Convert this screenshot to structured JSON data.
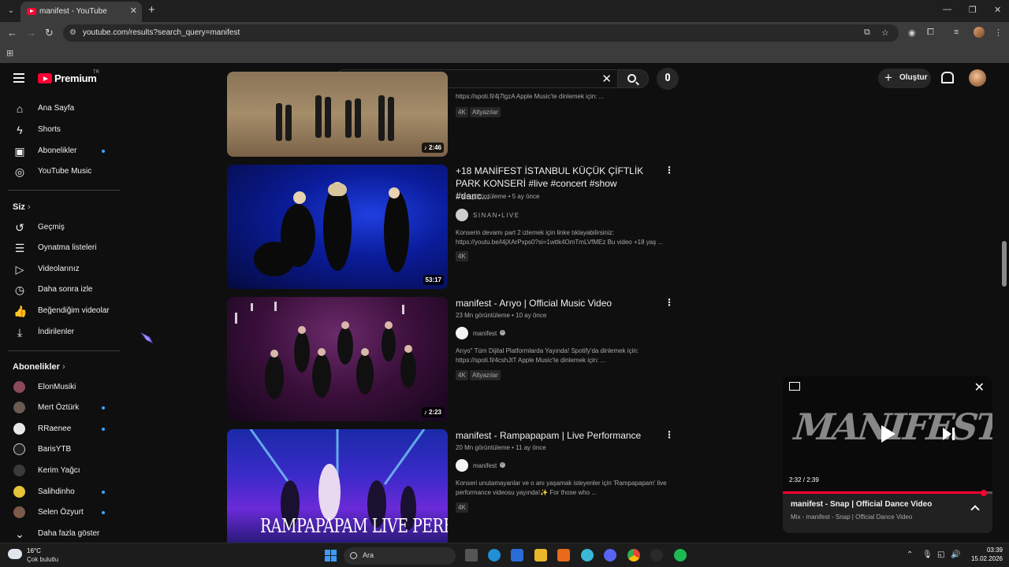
{
  "browser": {
    "tab_title": "manifest - YouTube",
    "tab_close": "✕",
    "new_tab": "+",
    "url": "youtube.com/results?search_query=manifest",
    "window_controls": [
      "—",
      "❐",
      "✕"
    ]
  },
  "masthead": {
    "logo_text": "Premium",
    "region": "TR",
    "search_value": "manifest",
    "create_label": "Oluştur"
  },
  "sidebar": {
    "main": [
      {
        "label": "Ana Sayfa",
        "icon": "home-icon",
        "glyph": "⌂"
      },
      {
        "label": "Shorts",
        "icon": "shorts-icon",
        "glyph": "ϟ"
      },
      {
        "label": "Abonelikler",
        "icon": "subscriptions-icon",
        "glyph": "▣",
        "dot": true
      },
      {
        "label": "YouTube Music",
        "icon": "youtube-music-icon",
        "glyph": "◎"
      }
    ],
    "you_heading": "Siz",
    "you": [
      {
        "label": "Geçmiş",
        "icon": "history-icon",
        "glyph": "↺"
      },
      {
        "label": "Oynatma listeleri",
        "icon": "playlists-icon",
        "glyph": "☰"
      },
      {
        "label": "Videolarınız",
        "icon": "your-videos-icon",
        "glyph": "▷"
      },
      {
        "label": "Daha sonra izle",
        "icon": "watch-later-icon",
        "glyph": "◷"
      },
      {
        "label": "Beğendiğim videolar",
        "icon": "liked-videos-icon",
        "glyph": "👍"
      },
      {
        "label": "İndirilenler",
        "icon": "downloads-icon",
        "glyph": "⤓"
      }
    ],
    "subs_heading": "Abonelikler",
    "subs": [
      {
        "label": "ElonMusiki",
        "color": "#8a4a5a",
        "dot": false
      },
      {
        "label": "Mert Öztürk",
        "color": "#6a5a50",
        "dot": true
      },
      {
        "label": "RRaenee",
        "color": "#e8e8e8",
        "dot": true
      },
      {
        "label": "BarisYTB",
        "color": "#222222",
        "dot": false
      },
      {
        "label": "Kerim Yağcı",
        "color": "#3a3a3a",
        "dot": false
      },
      {
        "label": "Salihdinho",
        "color": "#e6c43a",
        "dot": true
      },
      {
        "label": "Selen Özyurt",
        "color": "#7a5a4a",
        "dot": true
      }
    ],
    "show_more": "Daha fazla göster"
  },
  "results": [
    {
      "title": "",
      "meta": "",
      "channel": "",
      "desc": "https://spoti.fi/4j7lgzA Apple Music'te dinlemek için: ...",
      "badges": [
        "4K",
        "Altyazılar"
      ],
      "duration": "2:46",
      "music": true
    },
    {
      "title": "+18 MANİFEST İSTANBUL KÜÇÜK ÇİFTLİK PARK KONSERİ #live #concert #show #danc...",
      "meta": "1 Mn görüntüleme • 5 ay önce",
      "channel": "SINAN•LIVE",
      "verified": false,
      "desc": "Konserin devamı part 2 izlemek için linke tıklayabilirsiniz: https://youtu.be/l4jXArPxps0?si=1wttk4OmTmLVfMEz Bu video +18 yaş ...",
      "badges": [
        "4K"
      ],
      "duration": "53:17",
      "music": false
    },
    {
      "title": "manifest - Arıyo | Official Music Video",
      "meta": "23 Mn görüntüleme • 10 ay önce",
      "channel": "manifest",
      "verified": true,
      "desc": "Arıyo\" Tüm Dijital Platformlarda Yayında! Spotify'da dinlemek için: https://spoti.fi/4cshJtT Apple Music'te dinlemek için: ...",
      "badges": [
        "4K",
        "Altyazılar"
      ],
      "duration": "2:23",
      "music": true
    },
    {
      "title": "manifest - Rampapapam | Live Performance",
      "meta": "20 Mn görüntüleme • 11 ay önce",
      "channel": "manifest",
      "verified": true,
      "desc": "Konseri unutamayanlar ve o anı yaşamak isteyenler için 'Rampapapam' live performance videosu yayında!✨ For those who ...",
      "badges": [
        "4K"
      ],
      "duration": "",
      "music": false,
      "thumb_text": "RAMPAPAPAM LIVE PERFORMANCE"
    }
  ],
  "miniplayer": {
    "logo": "MANIFEST",
    "time": "2:32 / 2:39",
    "progress": 0.97,
    "title": "manifest - Snap | Official Dance Video",
    "subtitle": "Mix - manifest - Snap | Official Dance Video"
  },
  "taskbar": {
    "temp": "16°C",
    "weather": "Çok bulutlu",
    "search_placeholder": "Ara",
    "time": "03:39",
    "date": "15.02.2026"
  }
}
